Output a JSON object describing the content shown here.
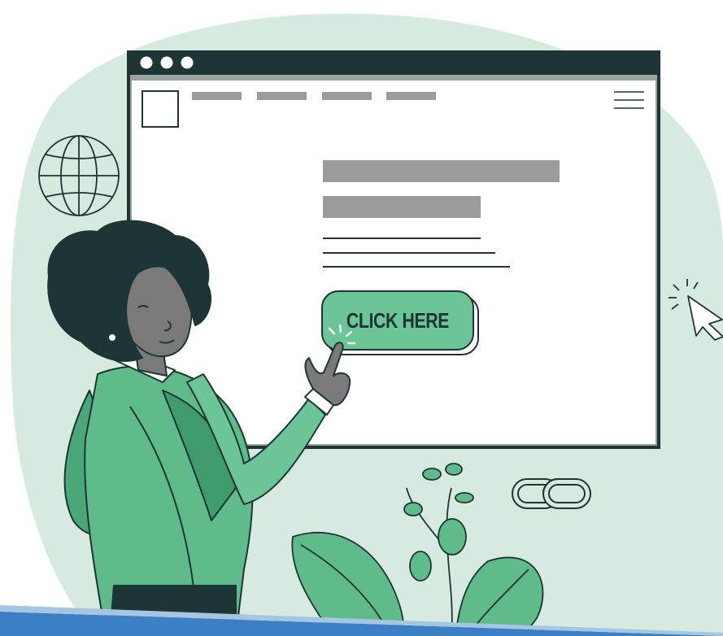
{
  "illustration": {
    "cta_button": {
      "label": "CLICK HERE"
    },
    "nav_placeholders": 4,
    "icons": [
      "globe-icon",
      "cursor-icon",
      "link-chain-icon",
      "hamburger-menu-icon",
      "logo-placeholder-icon"
    ]
  },
  "colors": {
    "blob": "#d6eae0",
    "window_frame": "#1e3535",
    "placeholder_gray": "#9b9b9b",
    "button_green": "#6cc596",
    "jacket_green": "#5fbb8a",
    "jacket_dark": "#3f9a6c",
    "skin": "#7a7a7a",
    "hair": "#1e3535",
    "bottom_bar": "#3b7fc4"
  }
}
